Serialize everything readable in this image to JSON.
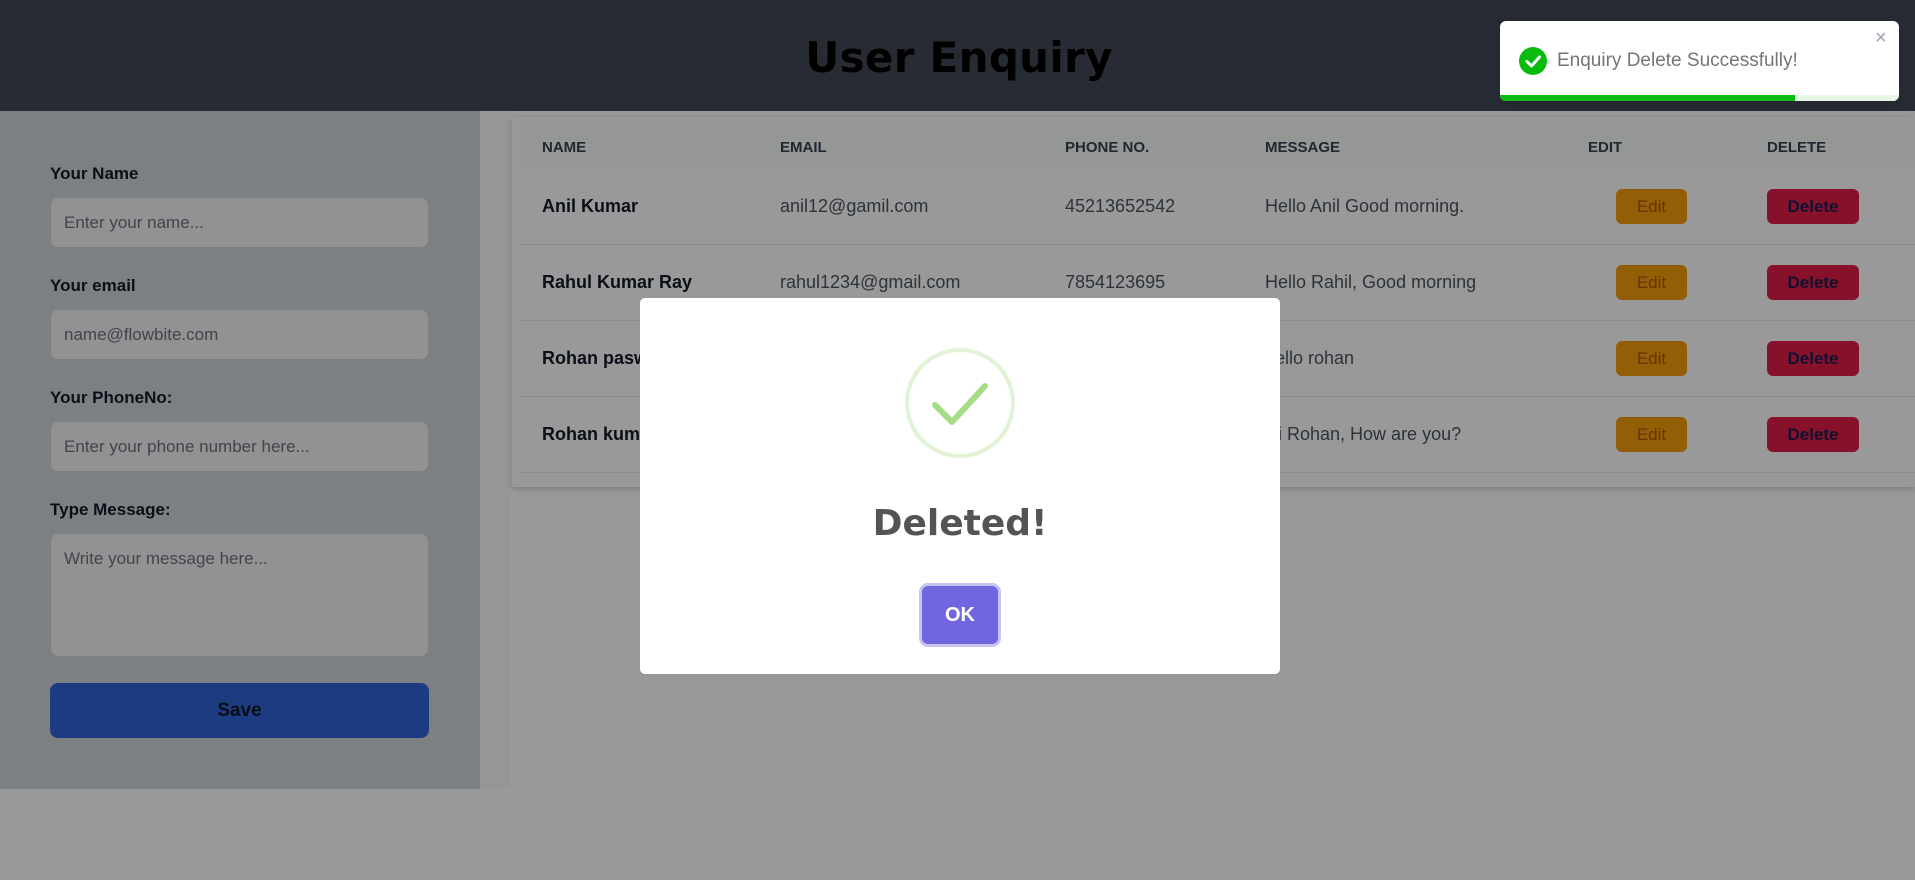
{
  "header": {
    "title": "User Enquiry"
  },
  "form": {
    "name_label": "Your Name",
    "name_placeholder": "Enter your name...",
    "email_label": "Your email",
    "email_placeholder": "name@flowbite.com",
    "phone_label": "Your PhoneNo:",
    "phone_placeholder": "Enter your phone number here...",
    "message_label": "Type Message:",
    "message_placeholder": "Write your message here...",
    "save_label": "Save"
  },
  "table": {
    "headers": [
      "NAME",
      "EMAIL",
      "PHONE NO.",
      "MESSAGE",
      "EDIT",
      "DELETE"
    ],
    "rows": [
      {
        "name": "Anil Kumar",
        "email": "anil12@gamil.com",
        "phone": "45213652542",
        "message": "Hello Anil Good morning.",
        "edit": "Edit",
        "delete": "Delete"
      },
      {
        "name": "Rahul Kumar Ray",
        "email": "rahul1234@gmail.com",
        "phone": "7854123695",
        "message": "Hello Rahil, Good morning",
        "edit": "Edit",
        "delete": "Delete"
      },
      {
        "name": "Rohan pasw",
        "email": "",
        "phone": "",
        "message": "hello rohan",
        "edit": "Edit",
        "delete": "Delete"
      },
      {
        "name": "Rohan kum",
        "email": "",
        "phone": "",
        "message": "Hi Rohan, How are you?",
        "edit": "Edit",
        "delete": "Delete"
      }
    ]
  },
  "modal": {
    "icon": "check-icon",
    "title": "Deleted!",
    "ok_label": "OK"
  },
  "toast": {
    "icon": "success-check-icon",
    "text": "Enquiry Delete Successfully!",
    "close_symbol": "×",
    "progress_fraction": 0.74
  },
  "colors": {
    "header_bg": "#414855",
    "save_button": "#2f63d6",
    "edit_button": "#f59e0b",
    "delete_button": "#e11d48",
    "ok_button": "#7066e0",
    "toast_success": "#07bc0c"
  }
}
